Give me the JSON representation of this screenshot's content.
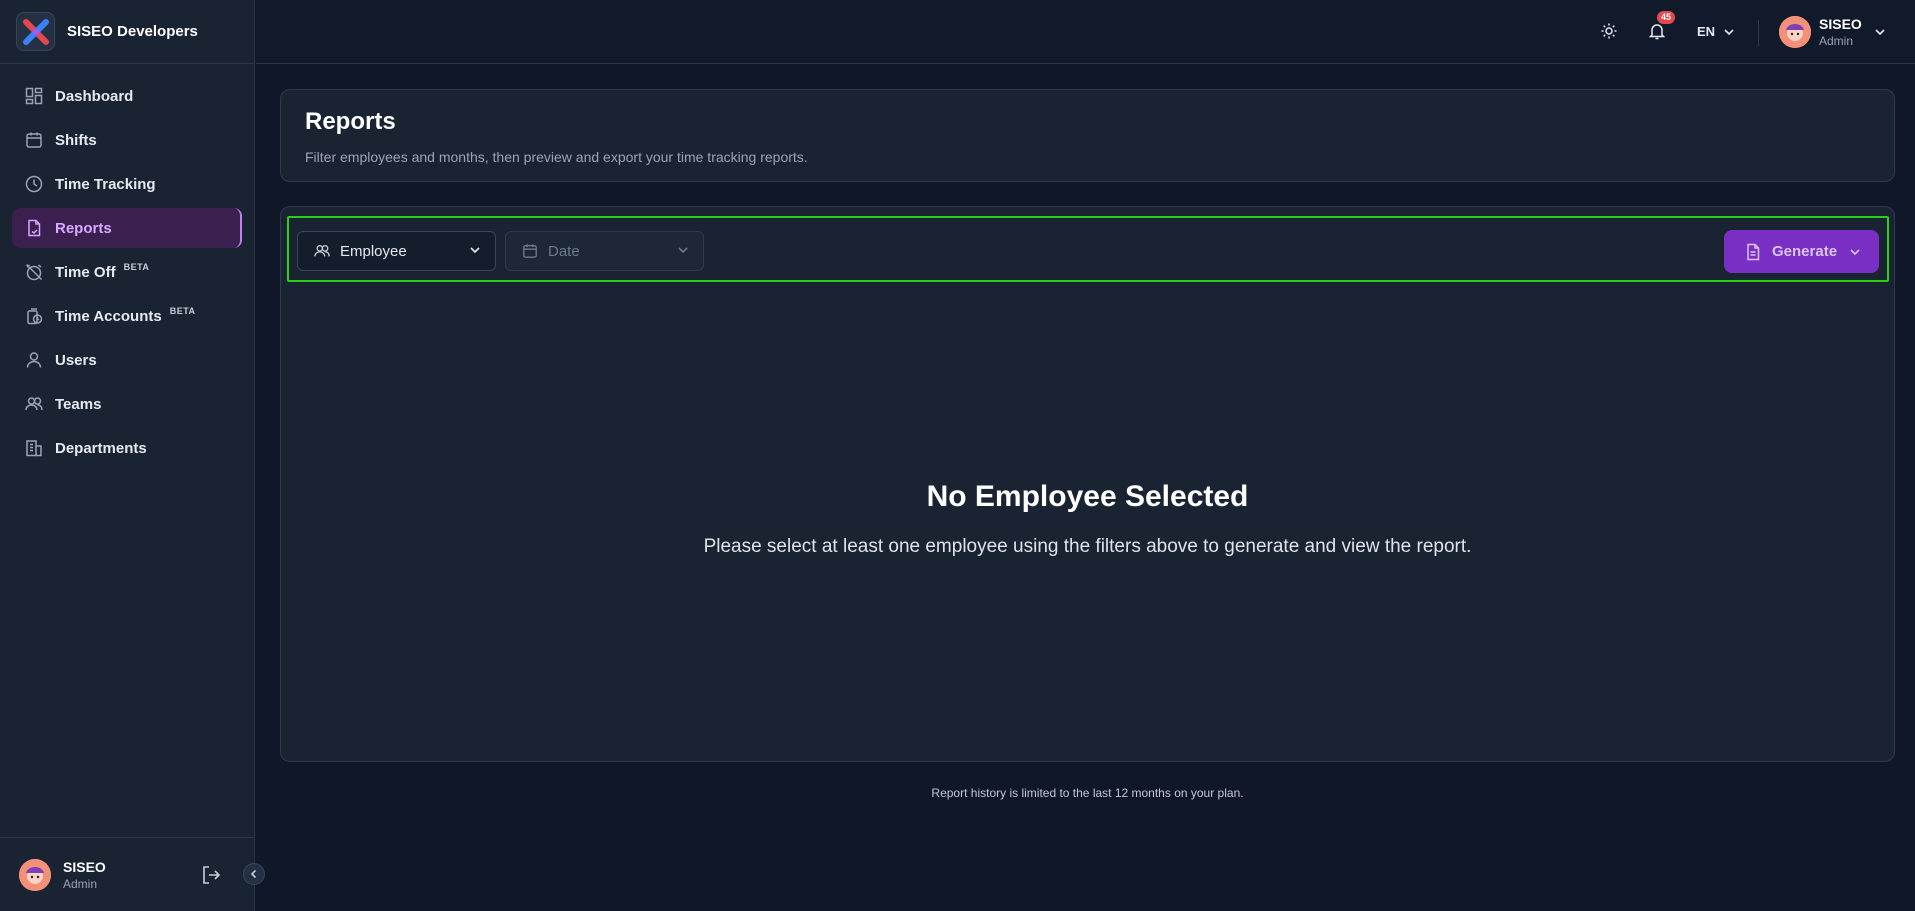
{
  "brand": {
    "name": "SISEO Developers",
    "logo_icon": "brand-logo-icon"
  },
  "sidebar": {
    "items": [
      {
        "label": "Dashboard",
        "icon": "dashboard-icon"
      },
      {
        "label": "Shifts",
        "icon": "calendar-icon"
      },
      {
        "label": "Time Tracking",
        "icon": "clock-icon"
      },
      {
        "label": "Reports",
        "icon": "report-icon",
        "active": true
      },
      {
        "label": "Time Off",
        "icon": "alarm-off-icon",
        "badge": "BETA"
      },
      {
        "label": "Time Accounts",
        "icon": "time-accounts-icon",
        "badge": "BETA"
      },
      {
        "label": "Users",
        "icon": "user-icon"
      },
      {
        "label": "Teams",
        "icon": "users-icon"
      },
      {
        "label": "Departments",
        "icon": "building-icon"
      }
    ],
    "user": {
      "name": "SISEO",
      "role": "Admin"
    }
  },
  "topbar": {
    "notifications_count": "45",
    "language": "EN",
    "user": {
      "name": "SISEO",
      "role": "Admin"
    }
  },
  "page": {
    "title": "Reports",
    "subtitle": "Filter employees and months, then preview and export your time tracking reports."
  },
  "filters": {
    "employee_label": "Employee",
    "date_label": "Date",
    "generate_label": "Generate"
  },
  "empty_state": {
    "title": "No Employee Selected",
    "description": "Please select at least one employee using the filters above to generate and view the report."
  },
  "footnote": "Report history is limited to the last 12 months on your plan.",
  "colors": {
    "background": "#0f1729",
    "panel": "#1a2332",
    "accent": "#7a2fc4",
    "active_nav": "#3b1f4f",
    "highlight": "#2ad217",
    "badge": "#e5484d"
  }
}
